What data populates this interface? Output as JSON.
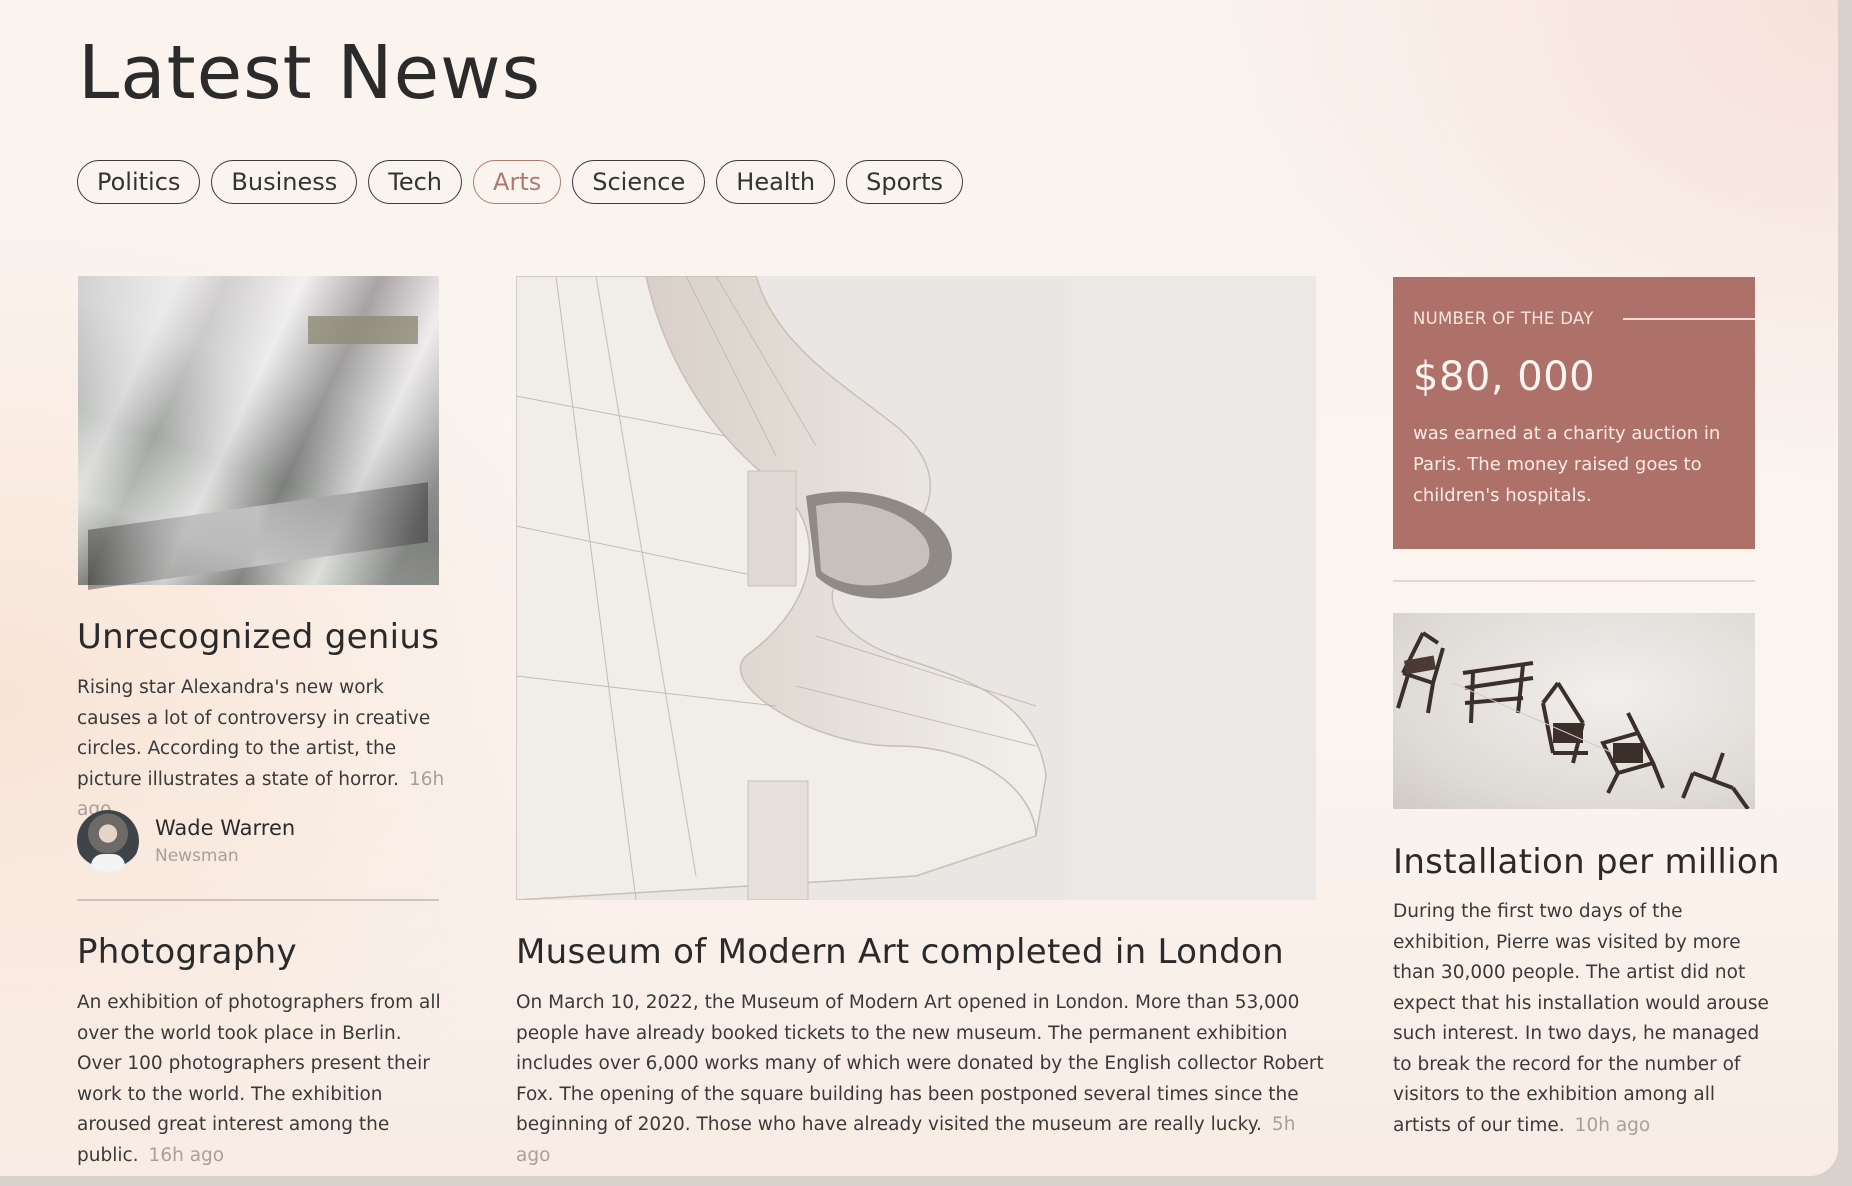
{
  "page": {
    "title": "Latest News"
  },
  "tabs": [
    {
      "label": "Politics",
      "active": false
    },
    {
      "label": "Business",
      "active": false
    },
    {
      "label": "Tech",
      "active": false
    },
    {
      "label": "Arts",
      "active": true
    },
    {
      "label": "Science",
      "active": false
    },
    {
      "label": "Health",
      "active": false
    },
    {
      "label": "Sports",
      "active": false
    }
  ],
  "colors": {
    "accent": "#ad7169",
    "active_tab": "#b07a72",
    "muted": "#a8a09a"
  },
  "articles": {
    "genius": {
      "title": "Unrecognized genius",
      "body": "Rising star Alexandra's new work causes a lot of controversy in creative circles. According to the artist, the picture illustrates a state of horror.",
      "time": "16h ago",
      "author": {
        "name": "Wade Warren",
        "role": "Newsman"
      }
    },
    "photography": {
      "title": "Photography",
      "body": "An exhibition of photographers from all over the world took place in Berlin. Over 100 photographers present their work to the world. The exhibition aroused great interest among the public.",
      "time": "16h ago"
    },
    "museum": {
      "title": "Museum of Modern Art completed in London",
      "body": "On March 10, 2022, the Museum of Modern Art opened in London. More than 53,000 people have already booked tickets to the new museum. The permanent exhibition includes over 6,000 works many of which were donated by the English collector Robert Fox. The opening of the square building has been postponed several times since the beginning of 2020. Those who have already visited the museum are really lucky.",
      "time": "5h ago"
    },
    "installation": {
      "title": "Installation per million",
      "body": "During the first two days of the exhibition, Pierre was visited by more than 30,000 people. The artist did not expect that his installation would arouse such interest. In two days, he managed to break the record for the number of visitors to the exhibition among all artists of our time.",
      "time": "10h ago"
    }
  },
  "number_of_day": {
    "label": "NUMBER OF THE DAY",
    "value": "$80, 000",
    "text": "was earned at a charity auction in Paris. The money raised goes to children's hospitals."
  }
}
